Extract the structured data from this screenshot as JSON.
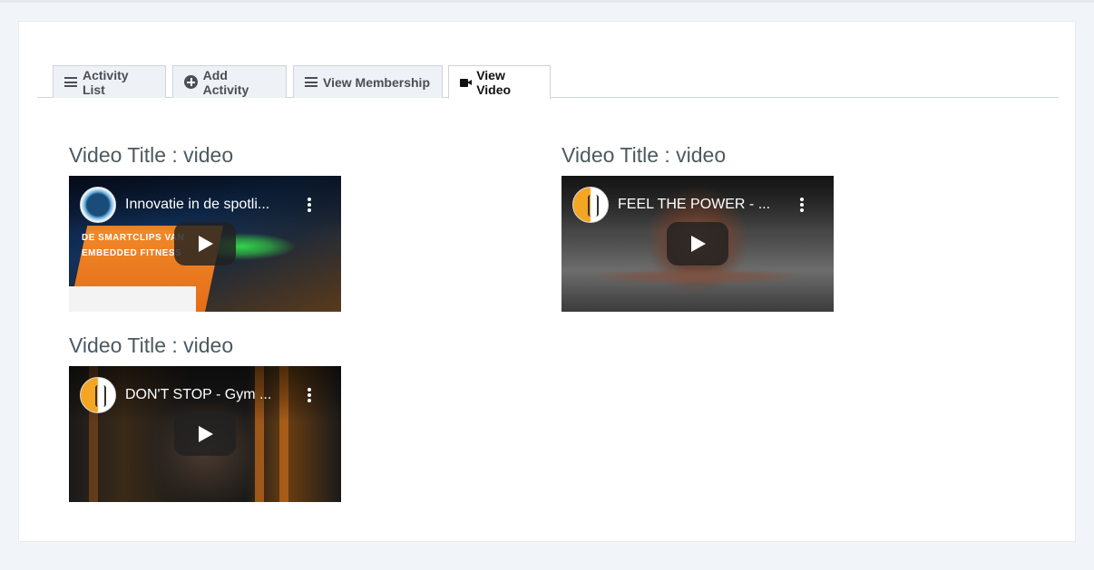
{
  "tabs": [
    {
      "label": "Activity List",
      "icon": "list-icon",
      "active": false
    },
    {
      "label": "Add Activity",
      "icon": "plus-circle-icon",
      "active": false
    },
    {
      "label": "View Membership",
      "icon": "list-icon",
      "active": false
    },
    {
      "label": "View Video",
      "icon": "video-camera-icon",
      "active": true
    }
  ],
  "videos": [
    {
      "heading": "Video Title : video",
      "player_title": "Innovatie in de spotli...",
      "thumb_text": "DE SMARTCLIPS VAN\nEMBEDDED FITNESS"
    },
    {
      "heading": "Video Title : video",
      "player_title": "FEEL THE POWER - ..."
    },
    {
      "heading": "Video Title : video",
      "player_title": "DON'T STOP - Gym ..."
    }
  ],
  "colors": {
    "page_bg": "#f1f4f8",
    "panel_bg": "#ffffff",
    "tab_bg": "#eef1f5",
    "tab_text": "#4a4f55",
    "heading_text": "#4d5961"
  }
}
